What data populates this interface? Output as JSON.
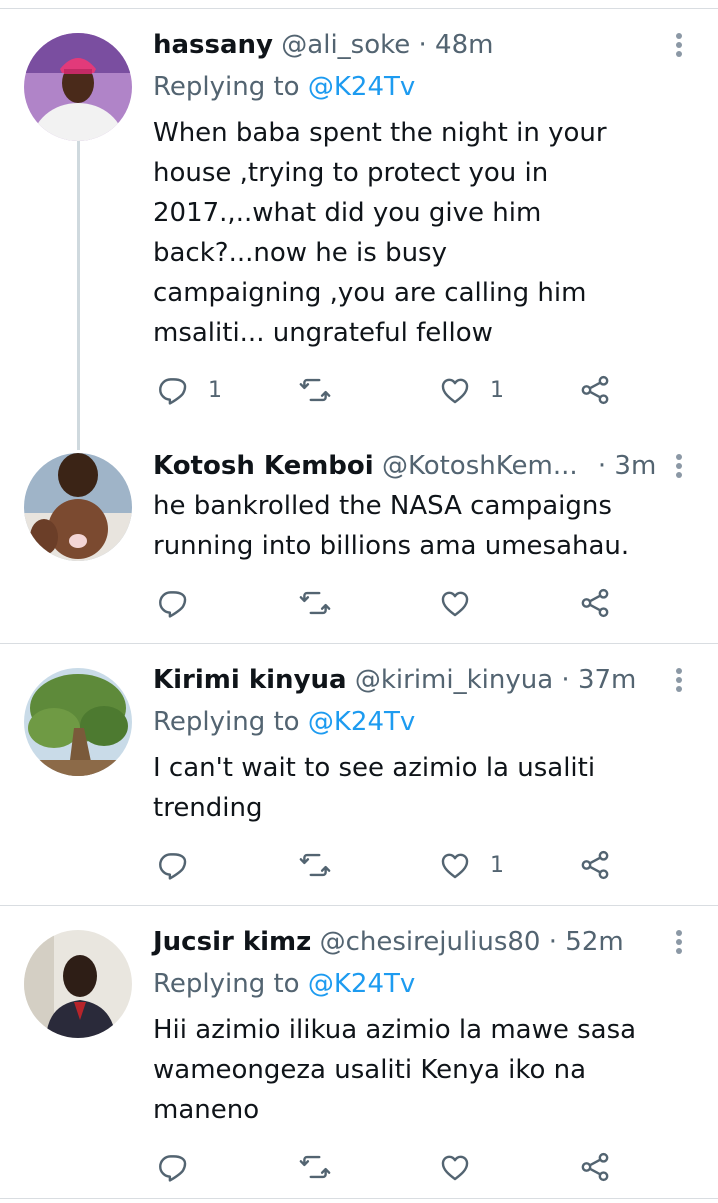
{
  "tweets": [
    {
      "display_name": "hassany",
      "handle": "@ali_soke",
      "separator": "·",
      "time": "48m",
      "replying_prefix": "Replying to",
      "replying_to": "@K24Tv",
      "text_lines": [
        "When baba spent the night in your",
        "house ,trying to protect you in",
        "2017.,..what did you give him",
        "back?...now he is busy",
        "campaigning ,you are  calling him",
        "msaliti... ungrateful fellow"
      ],
      "reply_count": "1",
      "like_count": "1"
    },
    {
      "display_name": "Kotosh Kemboi",
      "handle": "@KotoshKem...",
      "separator": "·",
      "time": "3m",
      "text_lines": [
        "he bankrolled the NASA campaigns",
        "running into billions ama umesahau."
      ],
      "reply_count": "",
      "like_count": ""
    },
    {
      "display_name": "Kirimi kinyua",
      "handle": "@kirimi_kinyua",
      "separator": "·",
      "time": "37m",
      "replying_prefix": "Replying to",
      "replying_to": "@K24Tv",
      "text_lines": [
        "I can't wait to see azimio la usaliti",
        "trending"
      ],
      "reply_count": "",
      "like_count": "1"
    },
    {
      "display_name": "Jucsir kimz",
      "handle": "@chesirejulius80",
      "separator": "·",
      "time": "52m",
      "replying_prefix": "Replying to",
      "replying_to": "@K24Tv",
      "text_lines": [
        "Hii azimio ilikua azimio la mawe sasa",
        "wameongeza usaliti Kenya iko na",
        "maneno"
      ],
      "reply_count": "",
      "like_count": ""
    }
  ],
  "icons": {
    "reply": "reply-bubble-icon",
    "retweet": "retweet-icon",
    "like": "heart-icon",
    "share": "share-icon",
    "more": "more-vertical-icon"
  },
  "colors": {
    "link": "#1d9bf0",
    "muted": "#536471",
    "text": "#0f1419",
    "icon": "#536471",
    "divider": "#d9dde1"
  }
}
